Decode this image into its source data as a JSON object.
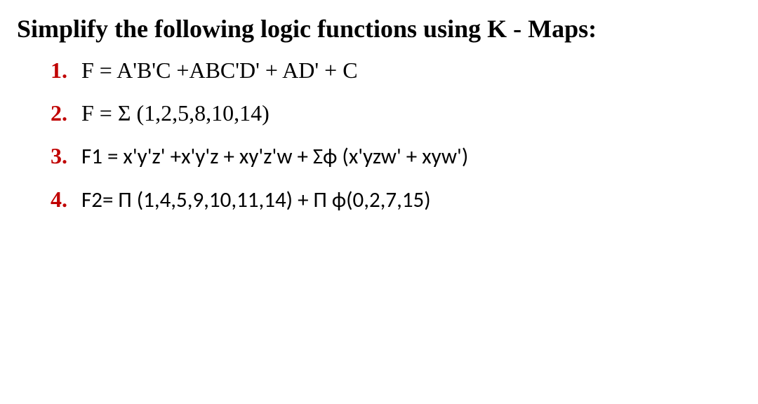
{
  "title": "Simplify the following logic functions using K - Maps:",
  "items": [
    {
      "number": "1.",
      "text": "F = A'B'C +ABC'D' + AD' + C"
    },
    {
      "number": "2.",
      "text": "F = Σ (1,2,5,8,10,14)"
    },
    {
      "number": "3.",
      "text": "F1 = x'y'z' +x'y'z + xy'z'w + Σϕ (x'yzw' + xyw')"
    },
    {
      "number": "4.",
      "text": "F2= Π (1,4,5,9,10,11,14) + Π ϕ(0,2,7,15)"
    }
  ]
}
